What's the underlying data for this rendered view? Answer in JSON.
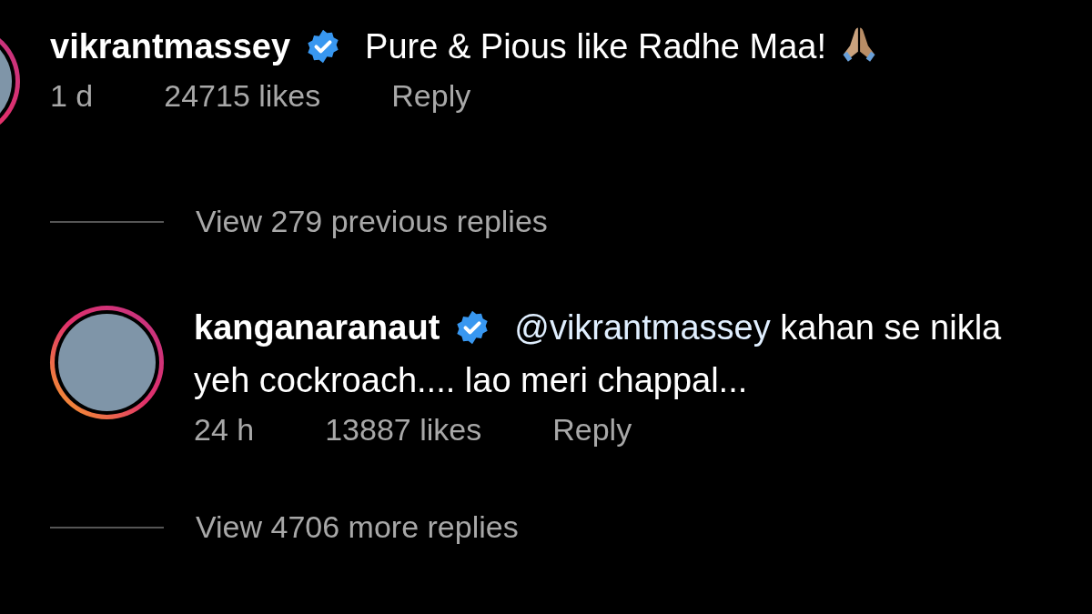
{
  "comments": [
    {
      "username": "vikrantmassey",
      "verified": true,
      "text": "Pure & Pious like Radhe Maa!",
      "has_emoji": true,
      "time": "1 d",
      "likes": "24715 likes",
      "reply_label": "Reply",
      "replies_link": "View 279 previous replies",
      "replies": [
        {
          "username": "kanganaranaut",
          "verified": true,
          "mention": "@vikrantmassey",
          "text": "kahan se nikla yeh cockroach.... lao meri chappal...",
          "has_emoji": false,
          "time": "24 h",
          "likes": "13887 likes",
          "reply_label": "Reply"
        }
      ],
      "more_replies": "View 4706 more replies"
    }
  ]
}
